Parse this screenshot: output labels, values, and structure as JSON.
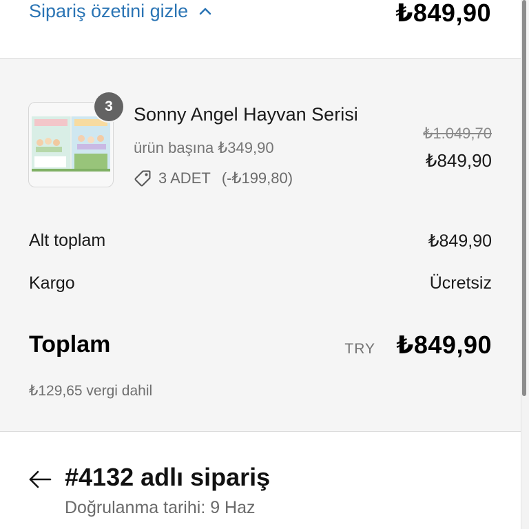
{
  "header": {
    "toggle_label": "Sipariş özetini gizle",
    "toggle_icon": "chevron-up-icon",
    "total": "₺849,90",
    "accent_color": "#2a74b4"
  },
  "product": {
    "name": "Sonny Angel Hayvan Serisi",
    "quantity": "3",
    "unit_price": "ürün başına ₺349,90",
    "discount_label": "3 ADET",
    "discount_amount": "(-₺199,80)",
    "discount_icon": "tag-icon",
    "original_price": "₺1.049,70",
    "price": "₺849,90"
  },
  "summary": {
    "subtotal_label": "Alt toplam",
    "subtotal_value": "₺849,90",
    "shipping_label": "Kargo",
    "shipping_value": "Ücretsiz",
    "total_label": "Toplam",
    "currency": "TRY",
    "total_value": "₺849,90",
    "tax_note": "₺129,65 vergi dahil"
  },
  "order": {
    "title": "#4132 adlı sipariş",
    "confirmation": "Doğrulanma tarihi: 9 Haz",
    "back_icon": "arrow-left-icon"
  }
}
